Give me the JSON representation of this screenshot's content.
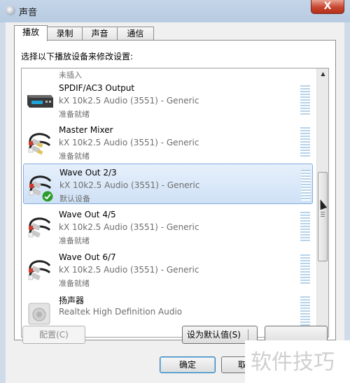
{
  "window": {
    "title": "声音",
    "close_label": "X"
  },
  "tabs": [
    {
      "label": "播放"
    },
    {
      "label": "录制"
    },
    {
      "label": "声音"
    },
    {
      "label": "通信"
    }
  ],
  "panel": {
    "prompt": "选择以下播放设备来修改设置:"
  },
  "devices": [
    {
      "name": "",
      "driver": "",
      "status": "未插入",
      "icon": "speaker-unplugged-icon"
    },
    {
      "name": "SPDIF/AC3 Output",
      "driver": "kX 10k2.5 Audio (3551) - Generic",
      "status": "准备就绪",
      "icon": "digital-output-device-icon"
    },
    {
      "name": "Master Mixer",
      "driver": "kX 10k2.5 Audio (3551) - Generic",
      "status": "准备就绪",
      "icon": "rca-cable-icon"
    },
    {
      "name": "Wave Out 2/3",
      "driver": "kX 10k2.5 Audio (3551) - Generic",
      "status": "默认设备",
      "icon": "rca-cable-icon",
      "selected": true,
      "default": true
    },
    {
      "name": "Wave Out 4/5",
      "driver": "kX 10k2.5 Audio (3551) - Generic",
      "status": "准备就绪",
      "icon": "rca-cable-icon"
    },
    {
      "name": "Wave Out 6/7",
      "driver": "kX 10k2.5 Audio (3551) - Generic",
      "status": "准备就绪",
      "icon": "rca-cable-icon"
    },
    {
      "name": "扬声器",
      "driver": "Realtek High Definition Audio",
      "status": "",
      "icon": "speaker-icon"
    }
  ],
  "buttons": {
    "configure": "配置(C)",
    "set_default": "设为默认值(S)",
    "properties": "",
    "ok": "确定",
    "cancel": "取"
  },
  "watermark": "软件技巧",
  "colors": {
    "selection": "#cfe1f6",
    "selection_border": "#84acdd",
    "default_check": "#2e9c2e"
  }
}
